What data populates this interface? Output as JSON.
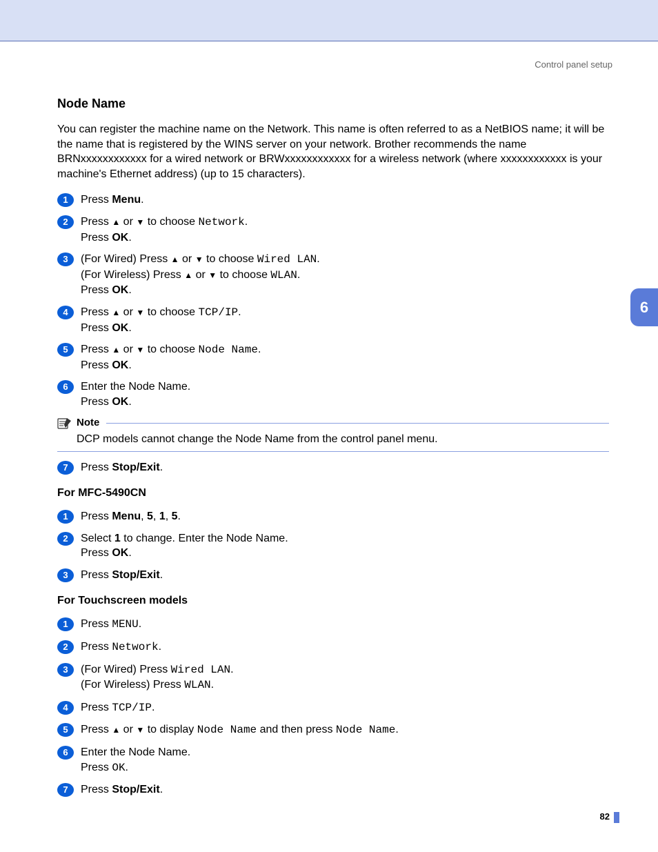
{
  "header": "Control panel setup",
  "title": "Node Name",
  "intro": "You can register the machine name on the Network. This name is often referred to as a NetBIOS name; it will be the name that is registered by the WINS server on your network. Brother recommends the name BRNxxxxxxxxxxxx for a wired network or BRWxxxxxxxxxxxx for a wireless network (where xxxxxxxxxxxx is your machine's Ethernet address) (up to 15 characters).",
  "s1": {
    "press": "Press ",
    "menu": "Menu",
    "dot": "."
  },
  "s2": {
    "press": "Press ",
    "up": "▲",
    "or": " or ",
    "down": "▼",
    "to": " to choose ",
    "network": "Network",
    "dot": ".",
    "pressok": "Press ",
    "ok": "OK",
    "dot2": "."
  },
  "s3": {
    "wired_pre": "(For Wired) Press ",
    "up": "▲",
    "or": " or ",
    "down": "▼",
    "to": " to choose ",
    "wiredlan": "Wired LAN",
    "dot": ".",
    "wless_pre": "(For Wireless) Press ",
    "wlan": "WLAN",
    "dot2": ".",
    "pressok": "Press ",
    "ok": "OK",
    "dot3": "."
  },
  "s4": {
    "press": "Press ",
    "up": "▲",
    "or": " or ",
    "down": "▼",
    "to": " to choose ",
    "tcpip": "TCP/IP",
    "dot": ".",
    "pressok": "Press ",
    "ok": "OK",
    "dot2": "."
  },
  "s5": {
    "press": "Press ",
    "up": "▲",
    "or": " or ",
    "down": "▼",
    "to": " to choose ",
    "node": "Node Name",
    "dot": ".",
    "pressok": "Press ",
    "ok": "OK",
    "dot2": "."
  },
  "s6": {
    "enter": "Enter the Node Name.",
    "pressok": "Press ",
    "ok": "OK",
    "dot": "."
  },
  "note": {
    "label": "Note",
    "body": "DCP models cannot change the Node Name from the control panel menu."
  },
  "s7": {
    "press": "Press ",
    "stop": "Stop/Exit",
    "dot": "."
  },
  "mfc_heading": "For MFC-5490CN",
  "m1": {
    "press": "Press ",
    "menu": "Menu",
    "c1": ", ",
    "n1": "5",
    "c2": ", ",
    "n2": "1",
    "c3": ", ",
    "n3": "5",
    "dot": "."
  },
  "m2": {
    "select": "Select ",
    "one": "1",
    "rest": " to change. Enter the Node Name.",
    "pressok": "Press ",
    "ok": "OK",
    "dot": "."
  },
  "m3": {
    "press": "Press ",
    "stop": "Stop/Exit",
    "dot": "."
  },
  "ts_heading": "For Touchscreen models",
  "t1": {
    "press": "Press ",
    "menu": "MENU",
    "dot": "."
  },
  "t2": {
    "press": "Press ",
    "network": "Network",
    "dot": "."
  },
  "t3": {
    "wired_pre": "(For Wired) Press ",
    "wiredlan": "Wired LAN",
    "dot": ".",
    "wless_pre": "(For Wireless) Press ",
    "wlan": "WLAN",
    "dot2": "."
  },
  "t4": {
    "press": "Press ",
    "tcpip": "TCP/IP",
    "dot": "."
  },
  "t5": {
    "press": "Press ",
    "up": "▲",
    "or": " or ",
    "down": "▼",
    "to": " to display ",
    "node": "Node Name",
    "then": " and then press ",
    "node2": "Node Name",
    "dot": "."
  },
  "t6": {
    "enter": "Enter the Node Name.",
    "pressok": "Press ",
    "ok": "OK",
    "dot": "."
  },
  "t7": {
    "press": "Press ",
    "stop": "Stop/Exit",
    "dot": "."
  },
  "chapter": "6",
  "page": "82"
}
